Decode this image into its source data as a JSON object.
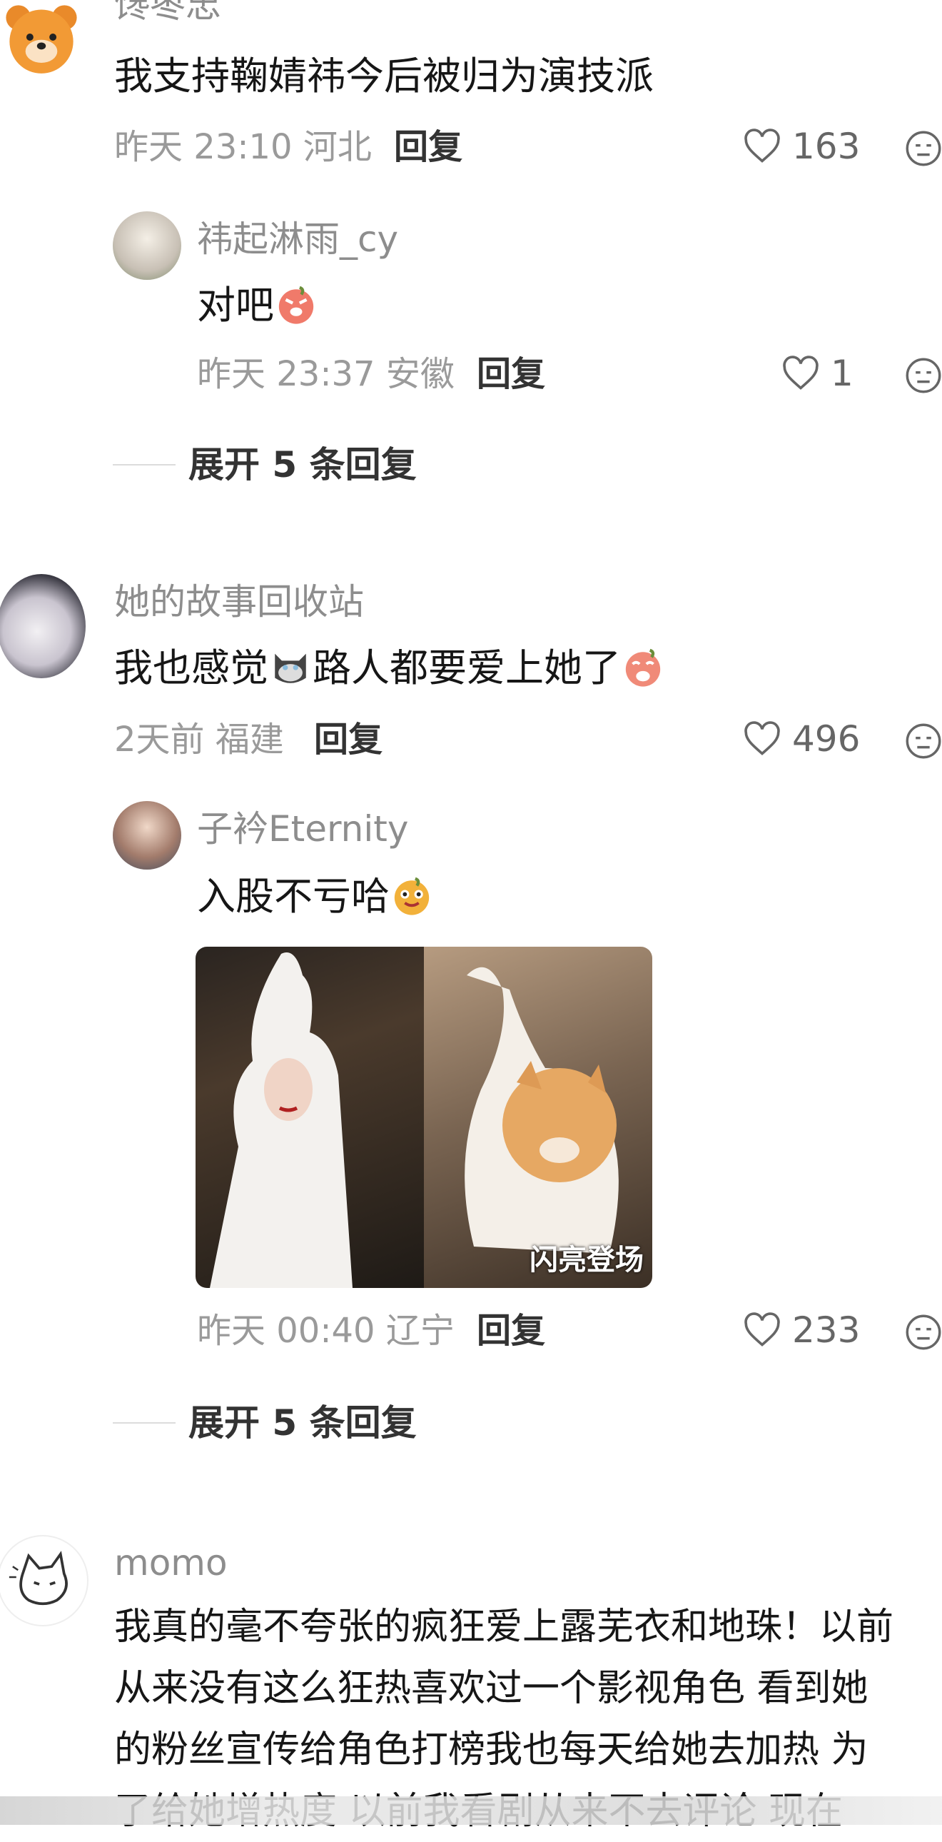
{
  "comments": [
    {
      "username": "馋枣忠",
      "text": "我支持鞠婧祎今后被归为演技派",
      "time": "昨天 23:10",
      "location": "河北",
      "reply_label": "回复",
      "likes": "163",
      "replies": [
        {
          "username": "祎起淋雨_cy",
          "text": "对吧",
          "time": "昨天 23:37",
          "location": "安徽",
          "reply_label": "回复",
          "likes": "1"
        }
      ],
      "expand_label": "展开 5 条回复"
    },
    {
      "username": "她的故事回收站",
      "text_part1": "我也感觉",
      "text_part2": "路人都要爱上她了",
      "time": "2天前",
      "location": "福建",
      "reply_label": "回复",
      "likes": "496",
      "replies": [
        {
          "username": "子衿Eternity",
          "text": "入股不亏哈",
          "image_caption": "闪亮登场",
          "time": "昨天 00:40",
          "location": "辽宁",
          "reply_label": "回复",
          "likes": "233"
        }
      ],
      "expand_label": "展开 5 条回复"
    },
    {
      "username": "momo",
      "lines": [
        "我真的毫不夸张的疯狂爱上露芜衣和地珠！以前",
        "从来没有这么狂热喜欢过一个影视角色 看到她",
        "的粉丝宣传给角色打榜我也每天给她去加热 为",
        "了给她增热度 以前我看剧从来不去评论 现在"
      ]
    }
  ],
  "colors": {
    "text": "#161616",
    "meta": "#9a9a9a",
    "name": "#8d8d8d",
    "reply": "#333333"
  },
  "icons": [
    "heart-outline-icon",
    "dislike-face-icon",
    "bear-avatar-icon",
    "cat-avatar-icon"
  ]
}
